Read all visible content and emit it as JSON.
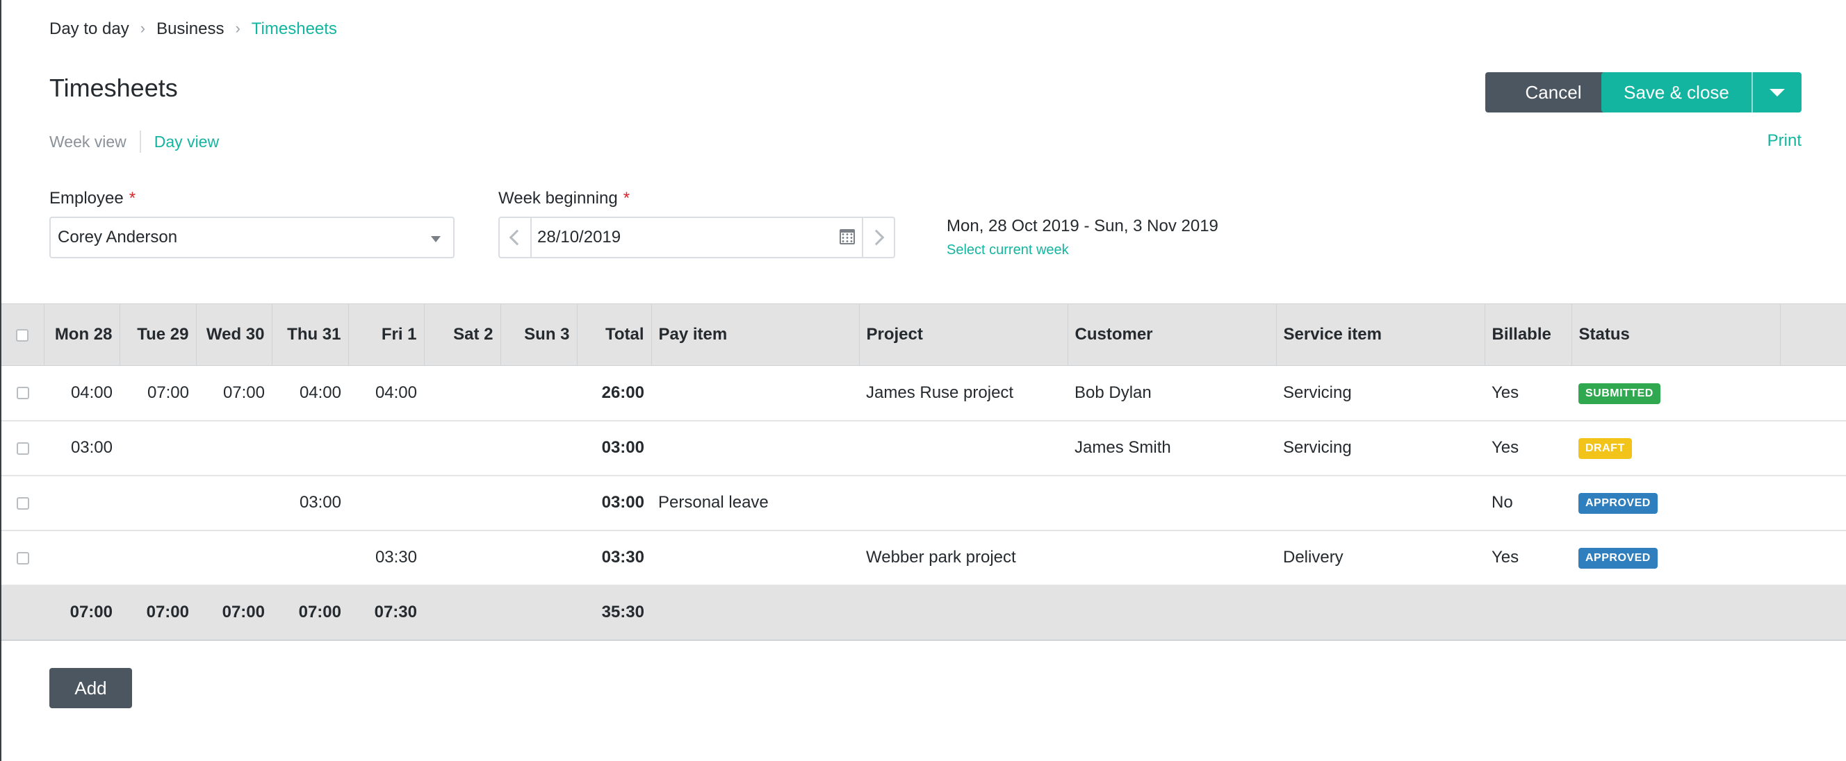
{
  "breadcrumb": [
    "Day to day",
    "Business",
    "Timesheets"
  ],
  "page_title": "Timesheets",
  "actions": {
    "cancel": "Cancel",
    "save": "Save & close"
  },
  "views": {
    "week": "Week view",
    "day": "Day view",
    "print": "Print"
  },
  "employee": {
    "label": "Employee",
    "required": "*",
    "value": "Corey Anderson"
  },
  "week_beginning": {
    "label": "Week beginning",
    "required": "*",
    "value": "28/10/2019"
  },
  "week_range": {
    "text": "Mon, 28 Oct 2019 - Sun, 3 Nov 2019",
    "link": "Select current week"
  },
  "table": {
    "headers": [
      "Mon 28",
      "Tue 29",
      "Wed 30",
      "Thu 31",
      "Fri 1",
      "Sat 2",
      "Sun 3",
      "Total",
      "Pay item",
      "Project",
      "Customer",
      "Service item",
      "Billable",
      "Status"
    ],
    "rows": [
      {
        "mon": "04:00",
        "tue": "07:00",
        "wed": "07:00",
        "thu": "04:00",
        "fri": "04:00",
        "sat": "",
        "sun": "",
        "total": "26:00",
        "pay_item": "",
        "project": "James Ruse project",
        "customer": "Bob Dylan",
        "service": "Servicing",
        "billable": "Yes",
        "status": "SUBMITTED",
        "status_color": "#2fa84f"
      },
      {
        "mon": "03:00",
        "tue": "",
        "wed": "",
        "thu": "",
        "fri": "",
        "sat": "",
        "sun": "",
        "total": "03:00",
        "pay_item": "",
        "project": "",
        "customer": "James Smith",
        "service": "Servicing",
        "billable": "Yes",
        "status": "DRAFT",
        "status_color": "#f2c318"
      },
      {
        "mon": "",
        "tue": "",
        "wed": "",
        "thu": "03:00",
        "fri": "",
        "sat": "",
        "sun": "",
        "total": "03:00",
        "pay_item": "Personal leave",
        "project": "",
        "customer": "",
        "service": "",
        "billable": "No",
        "status": "APPROVED",
        "status_color": "#2f7fbf"
      },
      {
        "mon": "",
        "tue": "",
        "wed": "",
        "thu": "",
        "fri": "03:30",
        "sat": "",
        "sun": "",
        "total": "03:30",
        "pay_item": "",
        "project": "Webber park project",
        "customer": "",
        "service": "Delivery",
        "billable": "Yes",
        "status": "APPROVED",
        "status_color": "#2f7fbf"
      }
    ],
    "totals": {
      "mon": "07:00",
      "tue": "07:00",
      "wed": "07:00",
      "thu": "07:00",
      "fri": "07:30",
      "sat": "",
      "sun": "",
      "total": "35:30"
    }
  },
  "add_label": "Add",
  "colors": {
    "accent": "#13b5a0",
    "dark_button": "#4b5660"
  }
}
